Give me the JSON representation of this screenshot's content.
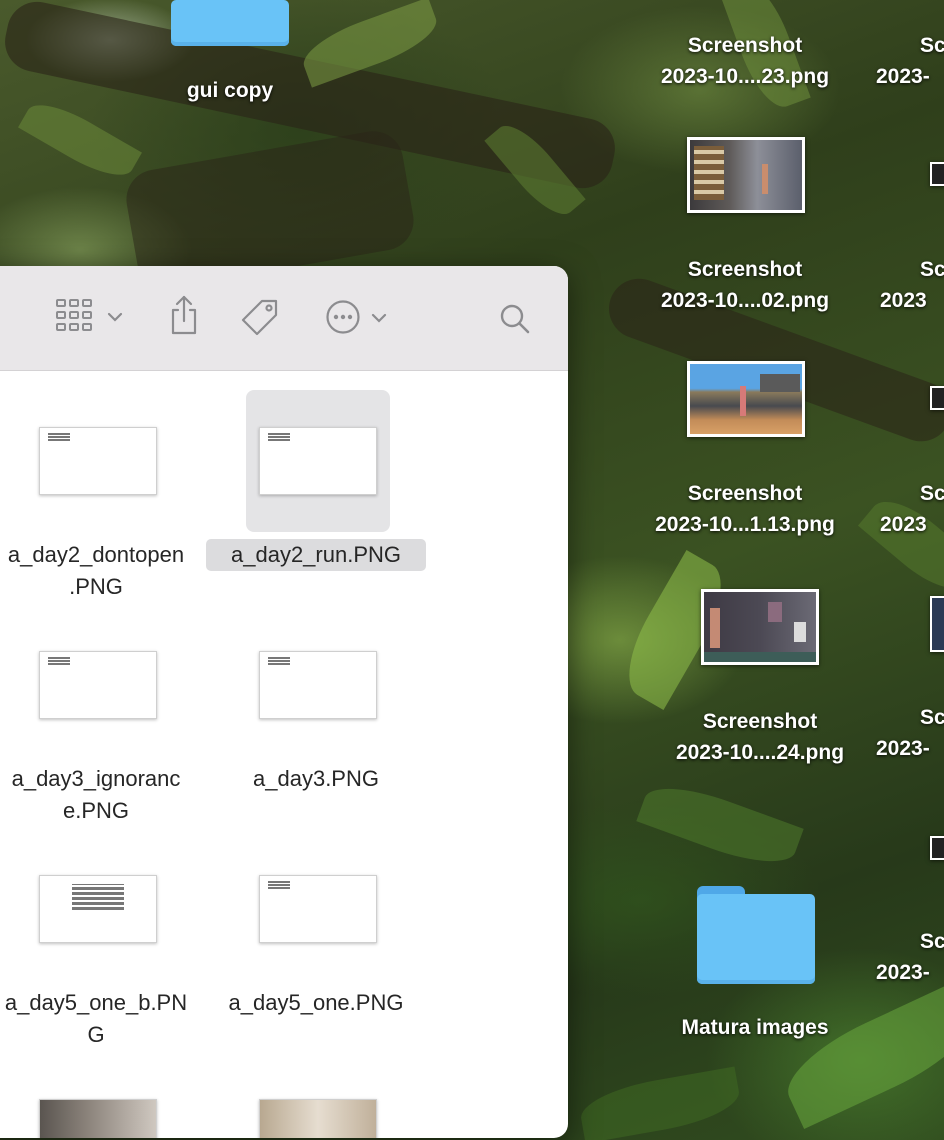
{
  "desktop": {
    "items": [
      {
        "kind": "folder",
        "label_lines": [
          "gui copy"
        ]
      },
      {
        "kind": "image",
        "label_lines": [
          "Screenshot",
          "2023-10....23.png"
        ]
      },
      {
        "kind": "image",
        "label_lines": [
          "Screenshot",
          "2023-10....02.png"
        ]
      },
      {
        "kind": "image",
        "label_lines": [
          "Screenshot",
          "2023-10...1.13.png"
        ]
      },
      {
        "kind": "image",
        "label_lines": [
          "Screenshot",
          "2023-10....24.png"
        ]
      },
      {
        "kind": "folder",
        "label_lines": [
          "Matura images"
        ]
      }
    ],
    "right_column": [
      {
        "label_lines": [
          "Sc",
          "2023-"
        ]
      },
      {
        "label_lines": [
          "Sc",
          "2023"
        ]
      },
      {
        "label_lines": [
          "Sc",
          "2023"
        ]
      },
      {
        "label_lines": [
          "Sc",
          "2023-"
        ]
      },
      {
        "label_lines": [
          "Sc",
          "2023-"
        ]
      }
    ]
  },
  "finder": {
    "toolbar": {
      "view_icon": "grid-view-icon",
      "share_icon": "share-icon",
      "tag_icon": "tag-icon",
      "more_icon": "ellipsis-circle-icon",
      "search_icon": "search-icon"
    },
    "files": [
      {
        "name_lines": [
          "a_day2_dontopen",
          ".PNG"
        ],
        "selected": false
      },
      {
        "name_lines": [
          "a_day2_run.PNG"
        ],
        "selected": true
      },
      {
        "name_lines": [
          "a_day3_ignoranc",
          "e.PNG"
        ],
        "selected": false
      },
      {
        "name_lines": [
          "a_day3.PNG"
        ],
        "selected": false
      },
      {
        "name_lines": [
          "a_day5_one_b.PN",
          "G"
        ],
        "selected": false
      },
      {
        "name_lines": [
          "a_day5_one.PNG"
        ],
        "selected": false
      }
    ]
  },
  "colors": {
    "folder_blue": "#69c3f7",
    "selection_gray": "#e4e4e6",
    "toolbar_bg": "#e9e7e9"
  }
}
